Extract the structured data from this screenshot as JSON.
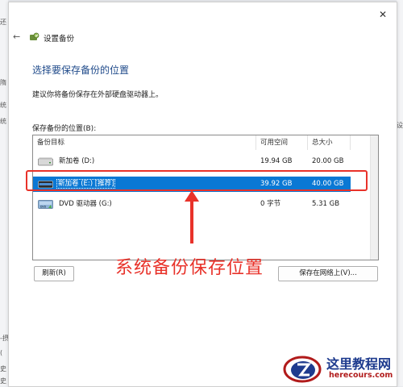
{
  "background": {
    "fragments": [
      "还",
      "隋",
      "统",
      "统",
      "设",
      "-摂",
      "(",
      "史",
      "史"
    ]
  },
  "dialog": {
    "title": "设置备份",
    "heading": "选择要保存备份的位置",
    "description": "建议你将备份保存在外部硬盘驱动器上。",
    "list_label": "保存备份的位置(B):",
    "columns": [
      "备份目标",
      "可用空间",
      "总大小"
    ],
    "rows": [
      {
        "name": "新加卷 (D:)",
        "free": "19.94 GB",
        "total": "20.00 GB",
        "icon": "drive-icon",
        "selected": false
      },
      {
        "name": "新加卷 (E:) [推荐]",
        "free": "39.92 GB",
        "total": "40.00 GB",
        "icon": "external-drive-icon",
        "selected": true
      },
      {
        "name": "DVD 驱动器 (G:)",
        "free": "0 字节",
        "total": "5.31 GB",
        "icon": "dvd-drive-icon",
        "selected": false
      }
    ],
    "refresh_label": "刷新(R)",
    "save_network_label": "保存在网络上(V)..."
  },
  "annotation": {
    "text": "系统备份保存位置",
    "color": "#e8322a"
  },
  "watermark": {
    "name": "这里教程网",
    "url": "herecours.com"
  },
  "colors": {
    "accent": "#0a78d4",
    "heading": "#1f4a8a"
  }
}
